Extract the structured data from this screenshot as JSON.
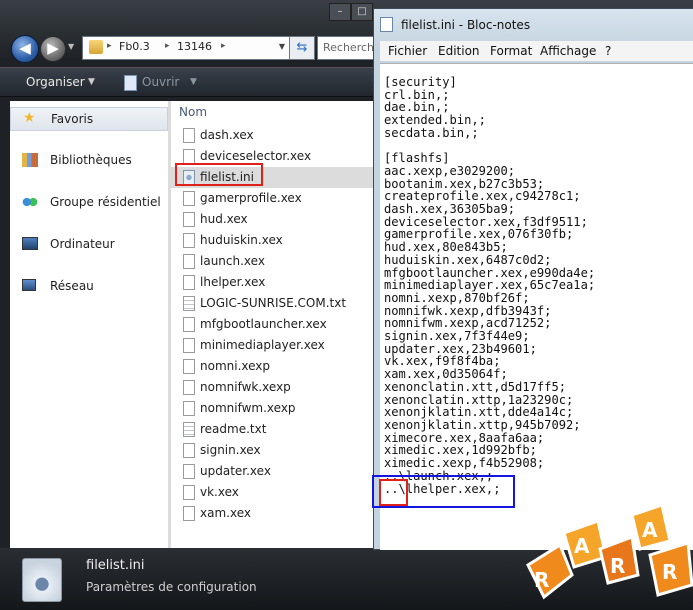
{
  "explorer": {
    "nav": {
      "back_glyph": "◀",
      "forward_glyph": "▶",
      "address_segments": [
        "Fb0.3",
        "13146"
      ],
      "search_placeholder": "Recherch"
    },
    "toolbar": {
      "organize_label": "Organiser",
      "open_label": "Ouvrir"
    },
    "nav_pane": {
      "items": [
        {
          "label": "Favoris",
          "icon": "star-icon",
          "selected": true
        },
        {
          "label": "Bibliothèques",
          "icon": "library-icon"
        },
        {
          "label": "Groupe résidentiel",
          "icon": "homegroup-icon"
        },
        {
          "label": "Ordinateur",
          "icon": "computer-icon"
        },
        {
          "label": "Réseau",
          "icon": "network-icon"
        }
      ]
    },
    "file_list": {
      "column_header": "Nom",
      "files": [
        {
          "name": "dash.xex"
        },
        {
          "name": "deviceselector.xex"
        },
        {
          "name": "filelist.ini",
          "selected": true
        },
        {
          "name": "gamerprofile.xex"
        },
        {
          "name": "hud.xex"
        },
        {
          "name": "huduiskin.xex"
        },
        {
          "name": "launch.xex"
        },
        {
          "name": "lhelper.xex"
        },
        {
          "name": "LOGIC-SUNRISE.COM.txt"
        },
        {
          "name": "mfgbootlauncher.xex"
        },
        {
          "name": "minimediaplayer.xex"
        },
        {
          "name": "nomni.xexp"
        },
        {
          "name": "nomnifwk.xexp"
        },
        {
          "name": "nomnifwm.xexp"
        },
        {
          "name": "readme.txt"
        },
        {
          "name": "signin.xex"
        },
        {
          "name": "updater.xex"
        },
        {
          "name": "vk.xex"
        },
        {
          "name": "xam.xex"
        }
      ]
    },
    "details": {
      "file_name": "filelist.ini",
      "file_type": "Paramètres de configuration"
    }
  },
  "notepad": {
    "title": "filelist.ini - Bloc-notes",
    "menu": [
      "Fichier",
      "Edition",
      "Format",
      "Affichage",
      "?"
    ],
    "content_lines": [
      "[security]",
      "crl.bin,;",
      "dae.bin,;",
      "extended.bin,;",
      "secdata.bin,;",
      "",
      "[flashfs]",
      "aac.xexp,e3029200;",
      "bootanim.xex,b27c3b53;",
      "createprofile.xex,c94278c1;",
      "dash.xex,36305ba9;",
      "deviceselector.xex,f3df9511;",
      "gamerprofile.xex,076f30fb;",
      "hud.xex,80e843b5;",
      "huduiskin.xex,6487c0d2;",
      "mfgbootlauncher.xex,e990da4e;",
      "minimediaplayer.xex,65c7ea1a;",
      "nomni.xexp,870bf26f;",
      "nomnifwk.xexp,dfb3943f;",
      "nomnifwm.xexp,acd71252;",
      "signin.xex,7f3f44e9;",
      "updater.xex,23b49601;",
      "vk.xex,f9f8f4ba;",
      "xam.xex,0d35064f;",
      "xenonclatin.xtt,d5d17ff5;",
      "xenonclatin.xttp,1a23290c;",
      "xenonjklatin.xtt,dde4a14c;",
      "xenonjklatin.xttp,945b7092;",
      "ximecore.xex,8aafa6aa;",
      "ximedic.xex,1d992bfb;",
      "ximedic.xexp,f4b52908;",
      "..\\launch.xex,;",
      "..\\lhelper.xex,;"
    ]
  },
  "watermark": {
    "text": "RARAR"
  },
  "colors": {
    "highlight_red": "#e0201a",
    "highlight_blue": "#1515e0",
    "logo_orange": "#f08a1c"
  }
}
